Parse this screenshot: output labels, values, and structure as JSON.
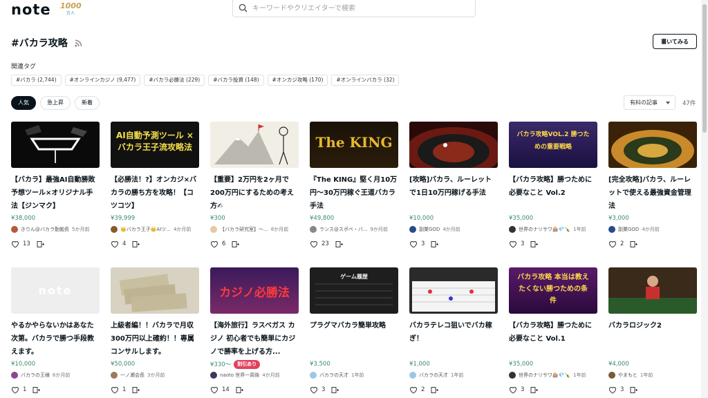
{
  "header": {
    "logo_text": "note",
    "badge_number": "1000",
    "badge_unit": "万人",
    "search_placeholder": "キーワードやクリエイターで検索"
  },
  "page": {
    "title": "#バカラ攻略",
    "write_button": "書いてみる",
    "related_label": "関連タグ",
    "tags": [
      "#バカラ (2,744)",
      "#オンラインカジノ (9,477)",
      "#バカラ必勝法 (229)",
      "#バカラ投資 (148)",
      "#オンカジ攻略 (170)",
      "#オンラインバカラ (32)"
    ],
    "sort_tabs": [
      "人気",
      "急上昇",
      "新着"
    ],
    "filter_select": "有料の記事",
    "count": "47件"
  },
  "cards": [
    {
      "title": "【バカラ】最強AI自動勝敗予想ツール×オリジナル手法【ジンマク】",
      "price": "¥38,000",
      "author": "きりん@バカラ勤勉長",
      "time": "5か月前",
      "likes": "13",
      "thumb_text": ""
    },
    {
      "title": "【必勝法！?】オンカジ×バカラの勝ち方を攻略！【コツコツ】",
      "price": "¥39,999",
      "author": "👑バカラ王子👑AIツ...",
      "time": "4か月前",
      "likes": "4",
      "thumb_text": "AI自動予測ツール × バカラ王子流攻略法"
    },
    {
      "title": "【重要】2万円を2ヶ月で200万円にするための考え方✍",
      "price": "¥300",
      "author": "【バカラ研究室】〜...",
      "time": "8か月前",
      "likes": "6",
      "thumb_text": ""
    },
    {
      "title": "『The KING』堅く月10万円〜30万円稼ぐ王道バカラ手法",
      "price": "¥49,800",
      "author": "ランス@スポベ・バ...",
      "time": "9か月前",
      "likes": "23",
      "thumb_text": "The KING"
    },
    {
      "title": "[攻略]バカラ、ルーレットで1日10万円稼げる手法",
      "price": "¥10,000",
      "author": "副業GOD",
      "time": "4か月前",
      "likes": "3",
      "thumb_text": ""
    },
    {
      "title": "【バカラ攻略】勝つために必要なこと Vol.2",
      "price": "¥35,000",
      "author": "世界のナリサワ🎰💎🍾",
      "time": "1年前",
      "likes": "3",
      "thumb_text": "バカラ攻略VOL.2 勝つための重要戦略"
    },
    {
      "title": "[完全攻略]バカラ、ルーレットで使える最強資金管理法",
      "price": "¥3,000",
      "author": "副業GOD",
      "time": "4か月前",
      "likes": "2",
      "thumb_text": ""
    },
    {
      "title": "やるかやらないかはあなた次第。バカラで勝つ手段教えます。",
      "price": "¥10,000",
      "author": "バカラの王様",
      "time": "6か月前",
      "likes": "1",
      "thumb_text": "note"
    },
    {
      "title": "上級者編！！バカラで月収300万円以上確約！！専属コンサルします。",
      "price": "¥50,000",
      "author": "一ノ瀬会長",
      "time": "3か月前",
      "likes": "1",
      "thumb_text": ""
    },
    {
      "title": "【海外旅行】ラスベガス カジノ 初心者でも簡単にカジノで勝率を上げる方...",
      "price": "¥330〜",
      "sale": "割引あり",
      "author": "naoto 世界一周後",
      "time": "4か月前",
      "likes": "14",
      "thumb_text": "カジノ必勝法"
    },
    {
      "title": "プラグマバカラ簡単攻略",
      "price": "¥3,500",
      "author": "バカラの天才",
      "time": "1年前",
      "likes": "3",
      "thumb_text": "ゲーム履歴"
    },
    {
      "title": "バカラテレコ狙いでバカ稼ぎ！",
      "price": "¥1,000",
      "author": "バカラの天才",
      "time": "1年前",
      "likes": "2",
      "thumb_text": ""
    },
    {
      "title": "【バカラ攻略】勝つために必要なこと Vol.1",
      "price": "¥35,000",
      "author": "世界のナリサワ🎰💎🍾",
      "time": "1年前",
      "likes": "3",
      "thumb_text": "バカラ攻略 本当は教えたくない勝つための条件"
    },
    {
      "title": "バカラロジック2",
      "price": "¥4,000",
      "author": "やまもと",
      "time": "1年前",
      "likes": "3",
      "thumb_text": ""
    }
  ],
  "colors": {
    "price": "#3a8b6b",
    "sale": "#e3405b",
    "text": "#08131a"
  },
  "icons": [
    "search-icon",
    "rss-icon",
    "heart-icon",
    "magazine-add-icon"
  ]
}
